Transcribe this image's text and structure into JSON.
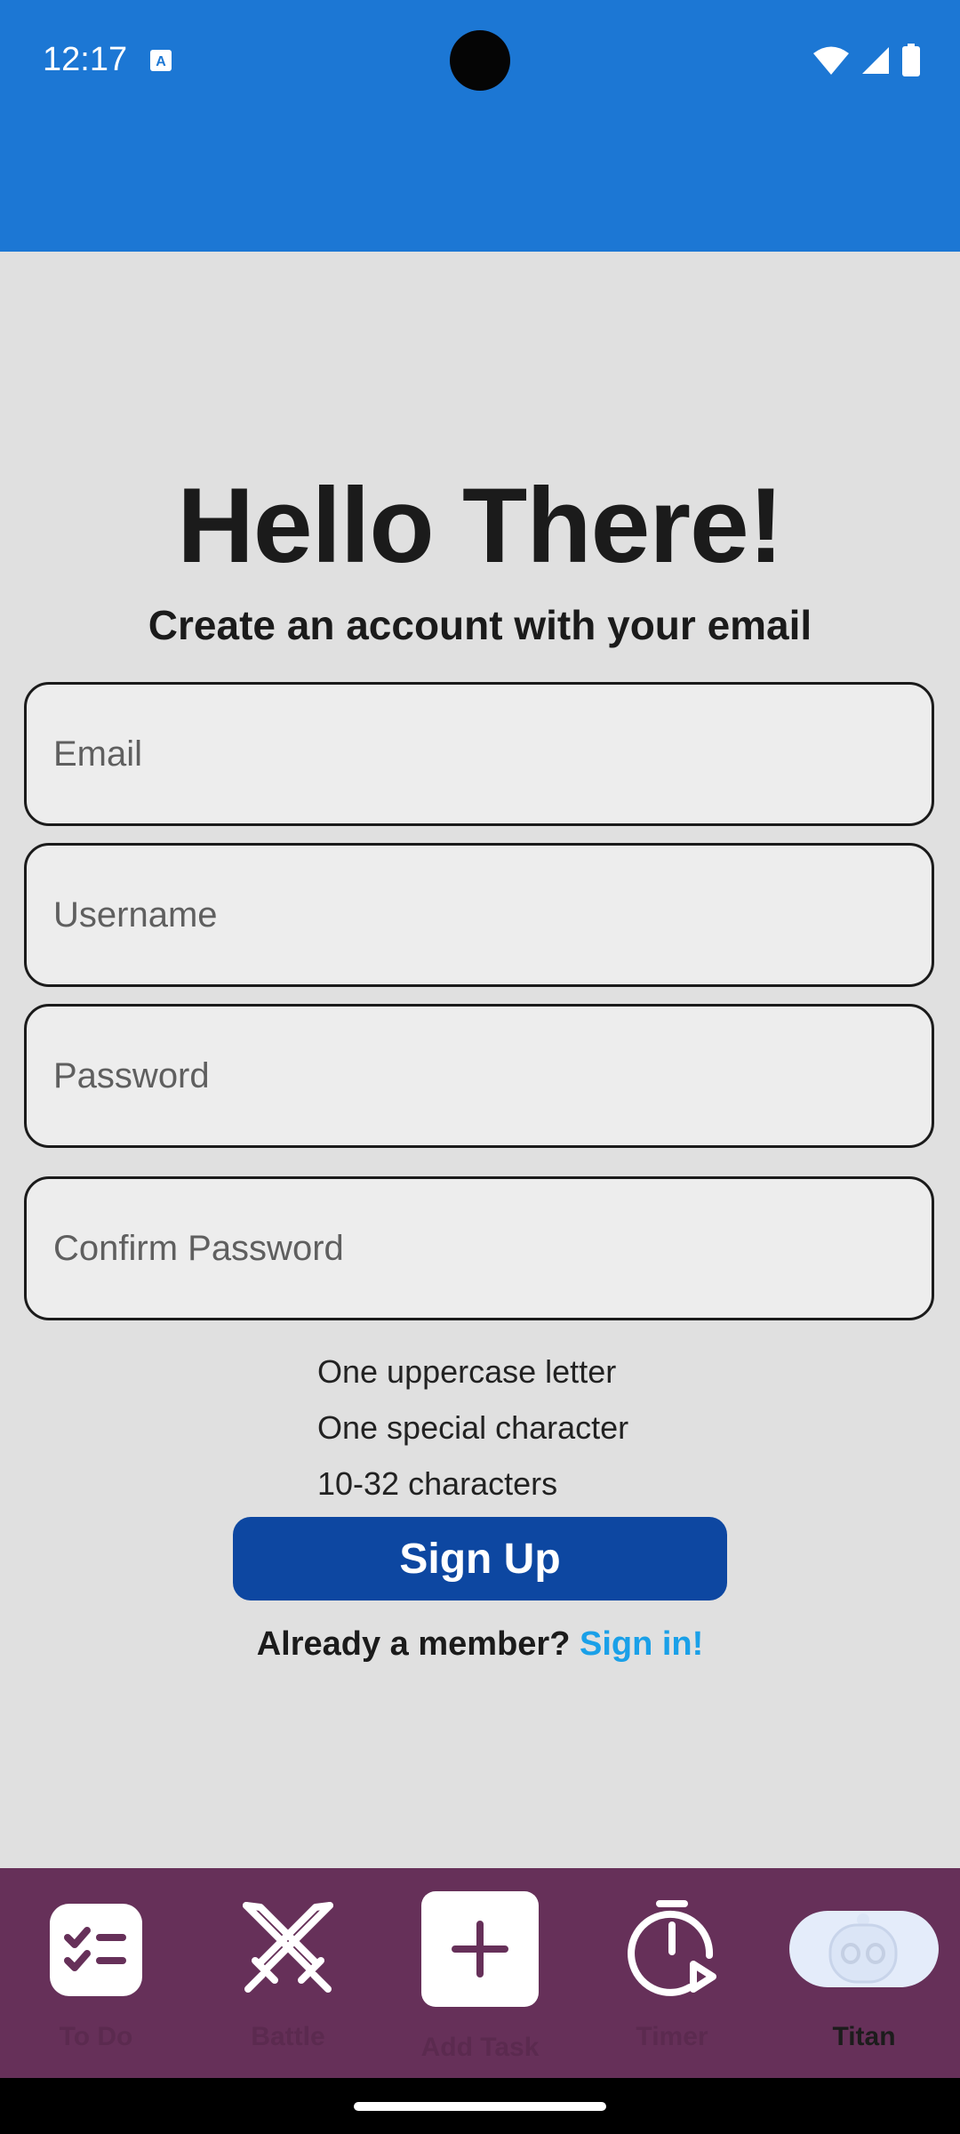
{
  "status_bar": {
    "time": "12:17",
    "icons": [
      "translate-notification-icon",
      "wifi-icon",
      "signal-icon",
      "battery-icon"
    ]
  },
  "colors": {
    "app_bar": "#1c77d4",
    "background": "#e0e0e0",
    "primary_button": "#0d47a1",
    "link": "#1aa0e8",
    "bottom_nav": "#663059"
  },
  "header": {
    "title": "Hello There!",
    "subtitle": "Create an account with your email"
  },
  "form": {
    "email_placeholder": "Email",
    "username_placeholder": "Username",
    "password_placeholder": "Password",
    "confirm_password_placeholder": "Confirm Password"
  },
  "requirements": [
    "One uppercase letter",
    "One special character",
    "10-32 characters"
  ],
  "signup_label": "Sign Up",
  "signin_prompt": "Already a member?",
  "signin_link": "Sign in!",
  "bottom_nav": {
    "items": [
      {
        "label": "To Do",
        "icon": "checklist-icon"
      },
      {
        "label": "Battle",
        "icon": "crossed-swords-icon"
      },
      {
        "label": "Add Task",
        "icon": "plus-icon"
      },
      {
        "label": "Timer",
        "icon": "timer-play-icon"
      },
      {
        "label": "Titan",
        "icon": "robot-avatar-icon",
        "selected": true
      }
    ]
  }
}
